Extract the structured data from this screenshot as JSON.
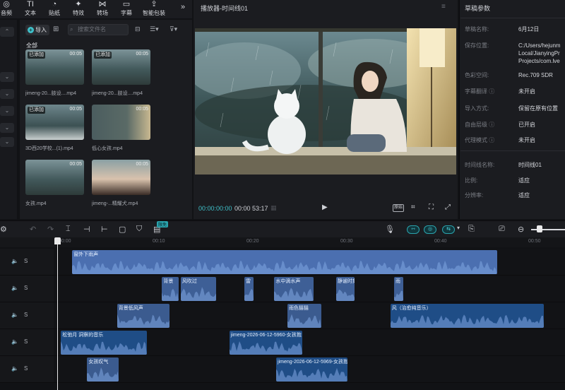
{
  "toolbar": {
    "items": [
      {
        "label": "音频",
        "icon": "music-note-icon"
      },
      {
        "label": "文本",
        "icon": "text-icon"
      },
      {
        "label": "贴纸",
        "icon": "sticker-icon"
      },
      {
        "label": "特效",
        "icon": "effects-icon"
      },
      {
        "label": "转场",
        "icon": "transition-icon"
      },
      {
        "label": "字幕",
        "icon": "subtitle-icon"
      },
      {
        "label": "智能包装",
        "icon": "smart-package-icon"
      }
    ],
    "more": "»"
  },
  "media": {
    "import_label": "导入",
    "search_placeholder": "搜索文件名",
    "tab_all": "全部",
    "items": [
      {
        "badge": "已添加",
        "duration": "00:05",
        "name": "jimeng-20...肢设....mp4",
        "scene": "rain"
      },
      {
        "badge": "已添加",
        "duration": "00:05",
        "name": "jimeng-20...肢设....mp4",
        "scene": "rain"
      },
      {
        "badge": "已添加",
        "duration": "00:05",
        "name": "3D西20学校...(1).mp4",
        "scene": "cat"
      },
      {
        "badge": "",
        "duration": "00:05",
        "name": "低心女孩.mp4",
        "scene": "girl-room"
      },
      {
        "badge": "",
        "duration": "00:05",
        "name": "女孩.mp4",
        "scene": "rain"
      },
      {
        "badge": "",
        "duration": "00:05",
        "name": "jimeng-...精耀犬.mp4",
        "scene": "face"
      }
    ]
  },
  "player": {
    "title": "播放器-时间线01",
    "current_time": "00:00:00:00",
    "total_time": "00:00 53:17",
    "ratio_label": "原始"
  },
  "params": {
    "title": "草稿参数",
    "rows": [
      {
        "label": "草稿名称:",
        "value": "6月12日"
      },
      {
        "label": "保存位置:",
        "value": "C:/Users/hejunm\nLocal/JianyingPr\nProjects/com.lve"
      },
      {
        "label": "色彩空间:",
        "value": "Rec.709 SDR"
      },
      {
        "label": "字幕翻译 ⓘ",
        "value": "未开启"
      },
      {
        "label": "导入方式:",
        "value": "保留在原有位置"
      },
      {
        "label": "自由层级 ⓘ",
        "value": "已开启"
      },
      {
        "label": "代理模式 ⓘ",
        "value": "未开启"
      },
      {
        "label": "时间线名称:",
        "value": "时间线01"
      },
      {
        "label": "比例:",
        "value": "适应"
      },
      {
        "label": "分辨率:",
        "value": "适应"
      }
    ]
  },
  "timeline": {
    "ruler_labels": [
      "00:00",
      "00:10",
      "00:20",
      "00:30",
      "00:40",
      "00:50"
    ],
    "free_badge": "限免",
    "track_solo": "S",
    "clips": [
      {
        "track": 0,
        "label": "窗外下雨声",
        "start": 0.8,
        "end": 23.5,
        "color": "#4b6fb0"
      },
      {
        "track": 1,
        "label": "背景",
        "start": 5.6,
        "end": 6.5,
        "color": "#3e5f96"
      },
      {
        "track": 1,
        "label": "风吹过",
        "start": 6.6,
        "end": 8.5,
        "color": "#3e5f96"
      },
      {
        "track": 1,
        "label": "雷",
        "start": 10.0,
        "end": 10.5,
        "color": "#3e5f96"
      },
      {
        "track": 1,
        "label": "水中滴水声",
        "start": 11.6,
        "end": 13.7,
        "color": "#3e5f96"
      },
      {
        "track": 1,
        "label": "静谧时刻",
        "start": 14.9,
        "end": 15.9,
        "color": "#3e5f96"
      },
      {
        "track": 1,
        "label": "雨",
        "start": 18.0,
        "end": 18.5,
        "color": "#3e5f96"
      },
      {
        "track": 2,
        "label": "背景低风声",
        "start": 3.2,
        "end": 6.0,
        "color": "#3b5b8f"
      },
      {
        "track": 2,
        "label": "雨色猫猫",
        "start": 12.3,
        "end": 14.1,
        "color": "#3b5b8f"
      },
      {
        "track": 2,
        "label": "风（治愈纯音乐）",
        "start": 17.8,
        "end": 26.0,
        "color": "#1f4d86"
      },
      {
        "track": 3,
        "label": "松弛月 洞察的音乐",
        "start": 0.2,
        "end": 4.8,
        "color": "#1f4d86"
      },
      {
        "track": 3,
        "label": "jimeng-2026-06-12-5960-女孩抱",
        "start": 9.2,
        "end": 13.1,
        "color": "#1f4d86"
      },
      {
        "track": 4,
        "label": "女孩叹气",
        "start": 1.6,
        "end": 3.3,
        "color": "#3b5b8f"
      },
      {
        "track": 4,
        "label": "jimeng-2026-06-12-5969-女孩抱",
        "start": 11.7,
        "end": 15.5,
        "color": "#1f4d86"
      }
    ]
  }
}
